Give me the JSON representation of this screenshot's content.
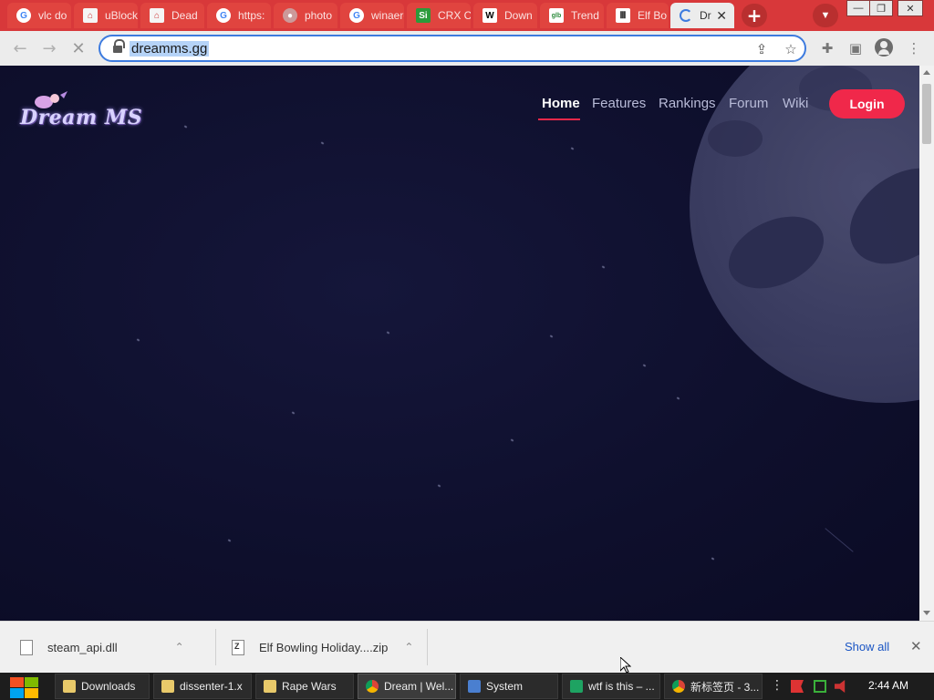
{
  "browser": {
    "tabs": [
      {
        "title": "vlc do",
        "favicon": "google-icon"
      },
      {
        "title": "uBlock",
        "favicon": "ublock-icon"
      },
      {
        "title": "Dead",
        "favicon": "deadpan-icon"
      },
      {
        "title": "https:",
        "favicon": "google-icon"
      },
      {
        "title": "photo",
        "favicon": "generic-page-icon"
      },
      {
        "title": "winaero",
        "favicon": "google-icon"
      },
      {
        "title": "CRX C",
        "favicon": "si-icon"
      },
      {
        "title": "Down",
        "favicon": "wikipedia-icon"
      },
      {
        "title": "Trend",
        "favicon": "glb-icon"
      },
      {
        "title": "Elf Bo",
        "favicon": "library-icon"
      },
      {
        "title": "Dr",
        "favicon": "loading-spinner-icon",
        "active": true
      }
    ],
    "new_tab_label": "+",
    "address": "dreamms.gg",
    "window_controls": [
      "—",
      "❐",
      "✕"
    ]
  },
  "site": {
    "logo_text": "Dream MS",
    "nav": [
      "Home",
      "Features",
      "Rankings",
      "Forum",
      "Wiki"
    ],
    "nav_active": "Home",
    "login_label": "Login",
    "accent_color": "#f0284a",
    "background_color": "#0f1030"
  },
  "downloads": {
    "items": [
      {
        "name": "steam_api.dll",
        "icon": "file-icon"
      },
      {
        "name": "Elf Bowling Holiday....zip",
        "icon": "zip-file-icon"
      }
    ],
    "show_all_label": "Show all",
    "close_label": "✕"
  },
  "taskbar": {
    "tasks": [
      {
        "label": "Downloads",
        "icon": "folder-icon"
      },
      {
        "label": "dissenter-1.x",
        "icon": "folder-icon"
      },
      {
        "label": "Rape Wars",
        "icon": "folder-icon"
      },
      {
        "label": "Dream | Wel...",
        "icon": "chrome-icon"
      },
      {
        "label": "System",
        "icon": "system-icon"
      },
      {
        "label": "wtf is this – ...",
        "icon": "sheets-icon"
      },
      {
        "label": "新标签页 - 3...",
        "icon": "chrome-canary-icon"
      }
    ],
    "clock": "2:44 AM"
  }
}
